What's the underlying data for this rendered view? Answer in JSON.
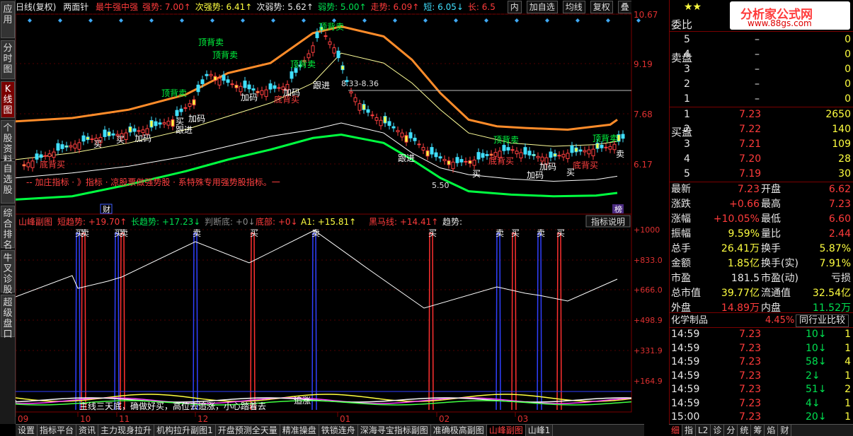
{
  "left_tabs": [
    "应用",
    "分时图",
    "K线图",
    "个股资料",
    "自选股",
    "综合排名",
    "牛叉诊股",
    "超级盘口"
  ],
  "main_header": {
    "period": "日线(复权)",
    "indicator": "两面针",
    "items": [
      {
        "label": "最牛强中强",
        "color": "#ff3b3b"
      },
      {
        "label": "强势: 7.00↑",
        "color": "#ff3b3b"
      },
      {
        "label": "次强势: 6.41↑",
        "color": "#ffff40"
      },
      {
        "label": "次弱势: 5.62↑",
        "color": "#e8e8e8"
      },
      {
        "label": "弱势: 5.00↑",
        "color": "#00e050"
      },
      {
        "label": "走势: 6.09↑",
        "color": "#ff3b3b"
      },
      {
        "label": "短: 6.05↓",
        "color": "#40e0ff"
      },
      {
        "label": "长: 6.5",
        "color": "#ff3b3b"
      }
    ],
    "buttons": [
      "内",
      "加自选",
      "均线",
      "复权",
      "叠",
      "窗",
      "预测"
    ]
  },
  "price_axis": [
    "10.67",
    "9.19",
    "7.68",
    "6.17"
  ],
  "main_annotations": {
    "range": "8.33-8.36",
    "low_price": "5.50",
    "label_cai": "财",
    "label_bang": "榜",
    "info_line": "-- 加庄指标 · 》指标 · 凉股票做强势股 · 系特殊专用强势股指标。一",
    "sell_top": "顶背卖",
    "buy_bottom": "底背买",
    "add": "加码",
    "follow": "跟进",
    "buy": "买",
    "sell": "卖"
  },
  "sub_header": {
    "name": "山峰副图",
    "items": [
      {
        "label": "短趋势: +19.70↑",
        "color": "#ff3b3b"
      },
      {
        "label": "长趋势: +17.23↓",
        "color": "#00e050"
      },
      {
        "label": "判断底: +0↓",
        "color": "#888888"
      },
      {
        "label": "底部: +0↓",
        "color": "#ff3b3b"
      },
      {
        "label": "A1: +15.81↑",
        "color": "#ffff40"
      },
      {
        "label": "黑马线: +14.41↑",
        "color": "#ff3b3b"
      },
      {
        "label": "趋势:",
        "color": "#e8e8e8"
      }
    ],
    "help_button": "指标说明"
  },
  "sub_axis": [
    "+1000",
    "+833.0",
    "+666.0",
    "+498.9",
    "+331.9",
    "+164.9"
  ],
  "sub_bottom_text": "主线三天底，确做好买，高位去追涨，小心踏着去",
  "sub_labels": {
    "buy": "买",
    "sell": "卖",
    "zhui": "追涨"
  },
  "date_axis": [
    "09",
    "10",
    "11",
    "12",
    "01",
    "02",
    "03"
  ],
  "right_panel": {
    "title": "委比",
    "sell_label": "卖盘",
    "buy_label": "买盘",
    "asks": [
      {
        "lvl": "5",
        "price": "–",
        "vol": "0"
      },
      {
        "lvl": "4",
        "price": "–",
        "vol": "0"
      },
      {
        "lvl": "3",
        "price": "–",
        "vol": "0"
      },
      {
        "lvl": "2",
        "price": "–",
        "vol": "0"
      },
      {
        "lvl": "1",
        "price": "–",
        "vol": "0"
      }
    ],
    "bids": [
      {
        "lvl": "1",
        "price": "7.23",
        "vol": "2650"
      },
      {
        "lvl": "2",
        "price": "7.22",
        "vol": "140"
      },
      {
        "lvl": "3",
        "price": "7.21",
        "vol": "109"
      },
      {
        "lvl": "4",
        "price": "7.20",
        "vol": "28"
      },
      {
        "lvl": "5",
        "price": "7.19",
        "vol": "30"
      }
    ],
    "stats": [
      {
        "l1": "最新",
        "v1": "7.23",
        "c1": "red",
        "l2": "开盘",
        "v2": "6.62",
        "c2": "red"
      },
      {
        "l1": "涨跌",
        "v1": "+0.66",
        "c1": "red",
        "l2": "最高",
        "v2": "7.23",
        "c2": "red"
      },
      {
        "l1": "涨幅",
        "v1": "+10.05%",
        "c1": "red",
        "l2": "最低",
        "v2": "6.60",
        "c2": "red"
      },
      {
        "l1": "振幅",
        "v1": "9.59%",
        "c1": "yel",
        "l2": "量比",
        "v2": "2.44",
        "c2": "red"
      },
      {
        "l1": "总手",
        "v1": "26.41万",
        "c1": "yel",
        "l2": "换手",
        "v2": "5.87%",
        "c2": "yel"
      },
      {
        "l1": "金额",
        "v1": "1.85亿",
        "c1": "yel",
        "l2": "换手(实)",
        "v2": "7.91%",
        "c2": "yel"
      },
      {
        "l1": "市盈",
        "v1": "181.5",
        "c1": "wht",
        "l2": "市盈(动)",
        "v2": "亏损",
        "c2": "wht"
      },
      {
        "l1": "总市值",
        "v1": "39.77亿",
        "c1": "yel",
        "l2": "流通值",
        "v2": "32.54亿",
        "c2": "yel"
      },
      {
        "l1": "外盘",
        "v1": "14.89万",
        "c1": "red",
        "l2": "内盘",
        "v2": "11.52万",
        "c2": "grn"
      }
    ],
    "industry": {
      "name": "化学制品",
      "pct": "4.45%",
      "compare": "同行业比较"
    },
    "ticks": [
      {
        "time": "14:59",
        "price": "7.23",
        "vol": "10",
        "dir": "↓",
        "n": "1"
      },
      {
        "time": "14:59",
        "price": "7.23",
        "vol": "10",
        "dir": "↓",
        "n": "1"
      },
      {
        "time": "14:59",
        "price": "7.23",
        "vol": "58",
        "dir": "↓",
        "n": "4"
      },
      {
        "time": "14:59",
        "price": "7.23",
        "vol": "2",
        "dir": "↓",
        "n": "1"
      },
      {
        "time": "14:59",
        "price": "7.23",
        "vol": "51",
        "dir": "↓",
        "n": "2"
      },
      {
        "time": "14:59",
        "price": "7.23",
        "vol": "4",
        "dir": "↓",
        "n": "1"
      },
      {
        "time": "15:00",
        "price": "7.23",
        "vol": "20",
        "dir": "↓",
        "n": "1"
      }
    ]
  },
  "bottom_tabs": [
    "设置",
    "指标平台",
    "资讯",
    "主力现身拉升",
    "机构拉升副图1",
    "开盘预测全天量",
    "精准操盘",
    "铁锁连舟",
    "深海寻宝指标副图",
    "准确极高副图",
    "山峰副图",
    "山峰1"
  ],
  "bottom_active": 10,
  "right_bottom_tabs": [
    "细",
    "指",
    "L2",
    "诊",
    "分",
    "统",
    "筹",
    "焰",
    "财"
  ],
  "right_bottom_active": 0,
  "logo": {
    "text": "分析家公式网",
    "url": "www.88gs.com",
    "stars": "★★"
  }
}
